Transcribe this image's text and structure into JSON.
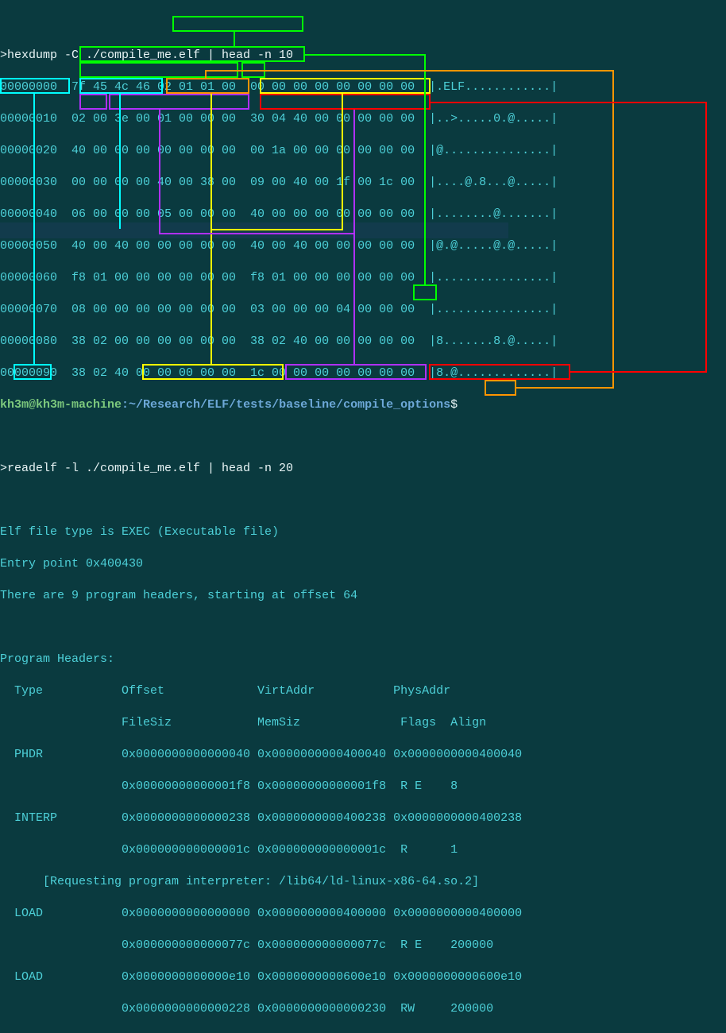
{
  "commands": {
    "hexdump": ">hexdump -C ./compile_me.elf | head -n 10",
    "readelf": ">readelf -l ./compile_me.elf | head -n 20"
  },
  "hexdump_lines": [
    "00000000  7f 45 4c 46 02 01 01 00  00 00 00 00 00 00 00 00  |.ELF............|",
    "00000010  02 00 3e 00 01 00 00 00  30 04 40 00 00 00 00 00  |..>.....0.@.....|",
    "00000020  40 00 00 00 00 00 00 00  00 1a 00 00 00 00 00 00  |@...............|",
    "00000030  00 00 00 00 40 00 38 00  09 00 40 00 1f 00 1c 00  |....@.8...@.....|",
    "00000040  06 00 00 00 05 00 00 00  40 00 00 00 00 00 00 00  |........@.......|",
    "00000050  40 00 40 00 00 00 00 00  40 00 40 00 00 00 00 00  |@.@.....@.@.....|",
    "00000060  f8 01 00 00 00 00 00 00  f8 01 00 00 00 00 00 00  |................|",
    "00000070  08 00 00 00 00 00 00 00  03 00 00 00 04 00 00 00  |................|",
    "00000080  38 02 00 00 00 00 00 00  38 02 40 00 00 00 00 00  |8.......8.@.....|",
    "00000090  38 02 40 00 00 00 00 00  1c 00 00 00 00 00 00 00  |8.@.............|"
  ],
  "prompt": {
    "user": "kh3m@kh3m-machine",
    "sep": ":",
    "path": "~/Research/ELF/tests/baseline/compile_options",
    "dollar": "$"
  },
  "readelf_output": {
    "filetype": "Elf file type is EXEC (Executable file)",
    "entry": "Entry point 0x400430",
    "headers_count": "There are 9 program headers, starting at offset 64",
    "section_title": "Program Headers:",
    "col_headers1": "  Type           Offset             VirtAddr           PhysAddr",
    "col_headers2": "                 FileSiz            MemSiz              Flags  Align",
    "rows": [
      "  PHDR           0x0000000000000040 0x0000000000400040 0x0000000000400040",
      "                 0x00000000000001f8 0x00000000000001f8  R E    8",
      "  INTERP         0x0000000000000238 0x0000000000400238 0x0000000000400238",
      "                 0x000000000000001c 0x000000000000001c  R      1",
      "      [Requesting program interpreter: /lib64/ld-linux-x86-64.so.2]",
      "  LOAD           0x0000000000000000 0x0000000000400000 0x0000000000400000",
      "                 0x000000000000077c 0x000000000000077c  R E    200000",
      "  LOAD           0x0000000000000e10 0x0000000000600e10 0x0000000000600e10",
      "                 0x0000000000000228 0x0000000000000230  RW     200000"
    ]
  },
  "annotations": {
    "offset64_box": "64",
    "phdr_box": "PHDR",
    "offset_val": "0x0000000000000040",
    "virtaddr_val": "0x0000000000400040",
    "physaddr_val": "0x0000000000400040"
  }
}
